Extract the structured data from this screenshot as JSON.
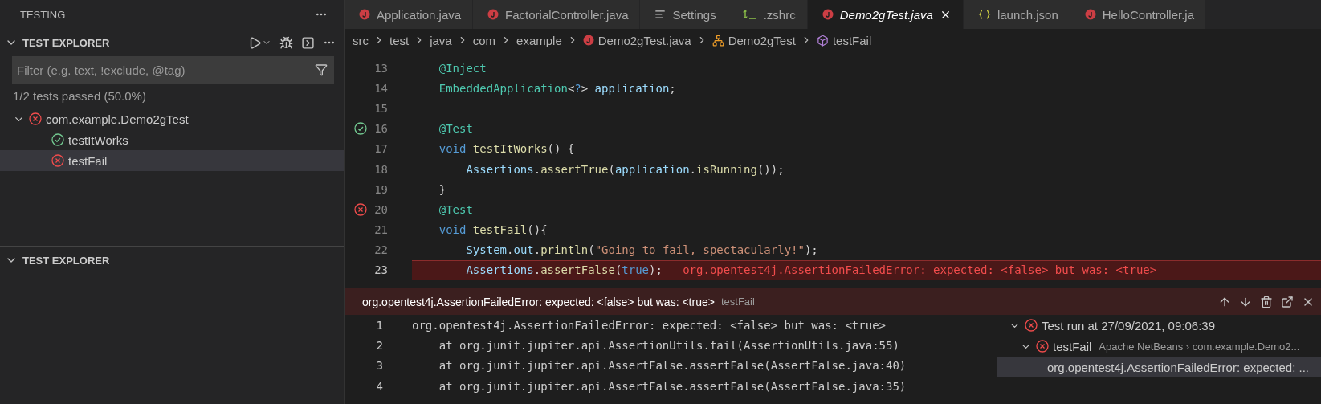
{
  "sidebar": {
    "title": "TESTING",
    "sections": [
      {
        "title": "TEST EXPLORER",
        "expanded": true,
        "filter": {
          "placeholder": "Filter (e.g. text, !exclude, @tag)"
        },
        "summary": "1/2 tests passed (50.0%)",
        "tree": [
          {
            "label": "com.example.Demo2gTest",
            "kind": "failed",
            "expanded": true,
            "selected": false,
            "children": [
              {
                "label": "testItWorks",
                "kind": "passed",
                "selected": false
              },
              {
                "label": "testFail",
                "kind": "failed",
                "selected": true
              }
            ]
          }
        ]
      },
      {
        "title": "TEST EXPLORER",
        "expanded": true
      }
    ]
  },
  "tabs": [
    {
      "label": "Application.java",
      "kind": "java",
      "selected": false
    },
    {
      "label": "FactorialController.java",
      "kind": "java",
      "selected": false
    },
    {
      "label": "Settings",
      "kind": "settings",
      "selected": false
    },
    {
      "label": ".zshrc",
      "kind": "shell",
      "selected": false
    },
    {
      "label": "Demo2gTest.java",
      "kind": "java",
      "selected": true
    },
    {
      "label": "launch.json",
      "kind": "json",
      "selected": false
    },
    {
      "label": "HelloController.ja",
      "kind": "java",
      "selected": false
    }
  ],
  "breadcrumbs": [
    {
      "label": "src",
      "kind": "folder"
    },
    {
      "label": "test",
      "kind": "folder"
    },
    {
      "label": "java",
      "kind": "folder"
    },
    {
      "label": "com",
      "kind": "folder"
    },
    {
      "label": "example",
      "kind": "folder"
    },
    {
      "label": "Demo2gTest.java",
      "kind": "java"
    },
    {
      "label": "Demo2gTest",
      "kind": "class"
    },
    {
      "label": "testFail",
      "kind": "method"
    }
  ],
  "editor": {
    "lines": [
      {
        "number": "13",
        "tokens": [
          {
            "text": "    @Inject",
            "kind": "type"
          }
        ]
      },
      {
        "number": "14",
        "tokens": [
          {
            "text": "    EmbeddedApplication",
            "kind": "type"
          },
          {
            "text": "<",
            "kind": "plain"
          },
          {
            "text": "?",
            "kind": "keyword"
          },
          {
            "text": "> ",
            "kind": "plain"
          },
          {
            "text": "application",
            "kind": "variable"
          },
          {
            "text": ";",
            "kind": "plain"
          }
        ]
      },
      {
        "number": "15"
      },
      {
        "number": "16",
        "kind": "passed",
        "tokens": [
          {
            "text": "    @Test",
            "kind": "type"
          }
        ]
      },
      {
        "number": "17",
        "tokens": [
          {
            "text": "    void ",
            "kind": "keyword"
          },
          {
            "text": "testItWorks",
            "kind": "function"
          },
          {
            "text": "() {",
            "kind": "plain"
          }
        ]
      },
      {
        "number": "18",
        "tokens": [
          {
            "text": "        Assertions",
            "kind": "variable"
          },
          {
            "text": ".",
            "kind": "plain"
          },
          {
            "text": "assertTrue",
            "kind": "function"
          },
          {
            "text": "(",
            "kind": "plain"
          },
          {
            "text": "application",
            "kind": "variable"
          },
          {
            "text": ".",
            "kind": "plain"
          },
          {
            "text": "isRunning",
            "kind": "function"
          },
          {
            "text": "());",
            "kind": "plain"
          }
        ]
      },
      {
        "number": "19",
        "tokens": [
          {
            "text": "    }",
            "kind": "plain"
          }
        ]
      },
      {
        "number": "20",
        "kind": "failed",
        "tokens": [
          {
            "text": "    @Test",
            "kind": "type"
          }
        ]
      },
      {
        "number": "21",
        "tokens": [
          {
            "text": "    void ",
            "kind": "keyword"
          },
          {
            "text": "testFail",
            "kind": "function"
          },
          {
            "text": "(){",
            "kind": "plain"
          }
        ]
      },
      {
        "number": "22",
        "tokens": [
          {
            "text": "        System",
            "kind": "variable"
          },
          {
            "text": ".",
            "kind": "plain"
          },
          {
            "text": "out",
            "kind": "variable"
          },
          {
            "text": ".",
            "kind": "plain"
          },
          {
            "text": "println",
            "kind": "function"
          },
          {
            "text": "(",
            "kind": "plain"
          },
          {
            "text": "\"Going to fail, spectacularly!\"",
            "kind": "string"
          },
          {
            "text": ");",
            "kind": "plain"
          }
        ]
      },
      {
        "number": "23",
        "current": true,
        "error": "org.opentest4j.AssertionFailedError: expected: <false> but was: <true>",
        "tokens": [
          {
            "text": "        Assertions",
            "kind": "variable"
          },
          {
            "text": ".",
            "kind": "plain"
          },
          {
            "text": "assertFalse",
            "kind": "function"
          },
          {
            "text": "(",
            "kind": "plain"
          },
          {
            "text": "true",
            "kind": "keyword"
          },
          {
            "text": ");",
            "kind": "plain"
          }
        ]
      }
    ]
  },
  "peek": {
    "title": "org.opentest4j.AssertionFailedError: expected: <false> but was: <true>",
    "subtitle": "testFail",
    "output": [
      {
        "number": "1",
        "text": "org.opentest4j.AssertionFailedError: expected: <false> but was: <true>"
      },
      {
        "number": "2",
        "text": "    at org.junit.jupiter.api.AssertionUtils.fail(AssertionUtils.java:55)"
      },
      {
        "number": "3",
        "text": "    at org.junit.jupiter.api.AssertFalse.assertFalse(AssertFalse.java:40)"
      },
      {
        "number": "4",
        "text": "    at org.junit.jupiter.api.AssertFalse.assertFalse(AssertFalse.java:35)"
      }
    ],
    "tree": [
      {
        "label": "Test run at 27/09/2021, 09:06:39",
        "kind": "failed",
        "expanded": true,
        "selected": false,
        "children": [
          {
            "label": "testFail",
            "description": "Apache NetBeans › com.example.Demo2...",
            "kind": "failed",
            "expanded": true,
            "selected": false,
            "children": [
              {
                "label": "org.opentest4j.AssertionFailedError: expected: ...",
                "selected": true
              }
            ]
          }
        ]
      }
    ]
  }
}
